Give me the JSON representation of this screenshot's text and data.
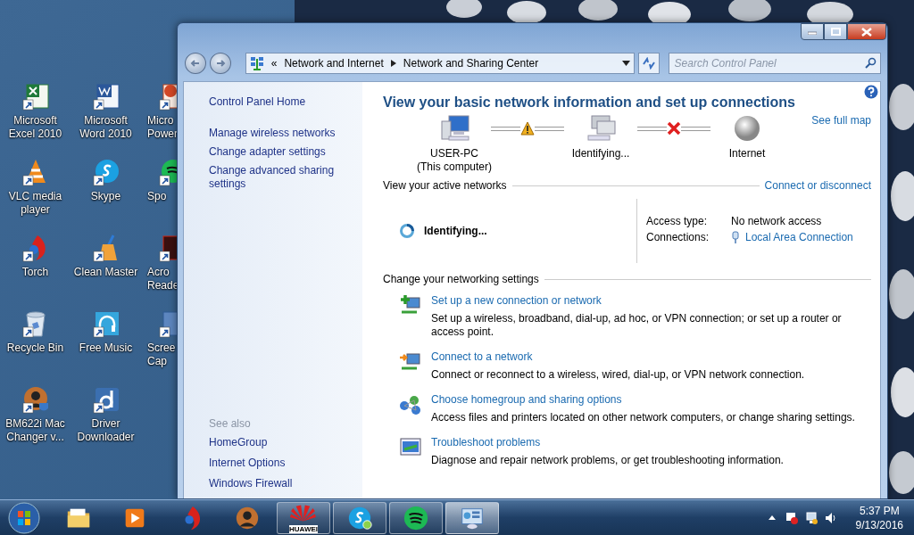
{
  "desktop": {
    "icons": [
      {
        "kind": "spreadsheet",
        "lines": [
          "Microsoft",
          "Excel 2010"
        ]
      },
      {
        "kind": "document",
        "lines": [
          "Microsoft",
          "Word 2010"
        ]
      },
      {
        "kind": "slides",
        "lines": [
          "Micro",
          "Power"
        ]
      },
      {
        "kind": "cone",
        "lines": [
          "VLC media",
          "player"
        ]
      },
      {
        "kind": "chat",
        "lines": [
          "Skype"
        ]
      },
      {
        "kind": "music",
        "lines": [
          "Spo"
        ]
      },
      {
        "kind": "flame",
        "lines": [
          "Torch"
        ]
      },
      {
        "kind": "broom",
        "lines": [
          "Clean Master"
        ]
      },
      {
        "kind": "reader",
        "lines": [
          "Acro",
          "Reade"
        ]
      },
      {
        "kind": "bin",
        "lines": [
          "Recycle Bin"
        ]
      },
      {
        "kind": "headphones",
        "lines": [
          "Free Music"
        ]
      },
      {
        "kind": "capture",
        "lines": [
          "Scree",
          "Cap"
        ]
      },
      {
        "kind": "avatar",
        "lines": [
          "BM622i Mac",
          "Changer v..."
        ]
      },
      {
        "kind": "download",
        "lines": [
          "Driver",
          "Downloader"
        ]
      }
    ]
  },
  "window": {
    "address": {
      "overflow": "«",
      "crumbs": [
        "Network and Internet",
        "Network and Sharing Center"
      ]
    },
    "search": {
      "placeholder": "Search Control Panel"
    },
    "sidebar": {
      "home": "Control Panel Home",
      "tasks": [
        "Manage wireless networks",
        "Change adapter settings",
        "Change advanced sharing settings"
      ],
      "see_also_heading": "See also",
      "see_also": [
        "HomeGroup",
        "Internet Options",
        "Windows Firewall"
      ]
    },
    "title": "View your basic network information and set up connections",
    "map": {
      "see_full_map": "See full map",
      "nodes": [
        {
          "kind": "computer",
          "lines": [
            "USER-PC",
            "(This computer)"
          ]
        },
        {
          "kind": "network",
          "lines": [
            "Identifying..."
          ]
        },
        {
          "kind": "globe",
          "lines": [
            "Internet"
          ]
        }
      ],
      "links": [
        {
          "kind": "warning"
        },
        {
          "kind": "broken"
        }
      ]
    },
    "active_networks": {
      "heading": "View your active networks",
      "action": "Connect or disconnect",
      "network_name": "Identifying...",
      "access_type_label": "Access type:",
      "access_type": "No network access",
      "connections_label": "Connections:",
      "connection": "Local Area Connection"
    },
    "settings": {
      "heading": "Change your networking settings",
      "items": [
        {
          "kind": "new",
          "link": "Set up a new connection or network",
          "description": "Set up a wireless, broadband, dial-up, ad hoc, or VPN connection; or set up a router or access point."
        },
        {
          "kind": "connect",
          "link": "Connect to a network",
          "description": "Connect or reconnect to a wireless, wired, dial-up, or VPN network connection."
        },
        {
          "kind": "homegroup",
          "link": "Choose homegroup and sharing options",
          "description": "Access files and printers located on other network computers, or change sharing settings."
        },
        {
          "kind": "troubleshoot",
          "link": "Troubleshoot problems",
          "description": "Diagnose and repair network problems, or get troubleshooting information."
        }
      ]
    }
  },
  "taskbar": {
    "items": [
      {
        "kind": "folder",
        "open": false,
        "selected": false
      },
      {
        "kind": "player",
        "open": false,
        "selected": false
      },
      {
        "kind": "flame",
        "open": false,
        "selected": false
      },
      {
        "kind": "avatar",
        "open": false,
        "selected": false
      },
      {
        "kind": "huawei",
        "label": "HUAWEI",
        "open": true,
        "selected": false
      },
      {
        "kind": "chat",
        "open": true,
        "selected": false
      },
      {
        "kind": "music",
        "open": true,
        "selected": false
      },
      {
        "kind": "panel",
        "open": true,
        "selected": true
      }
    ],
    "time": "5:37 PM",
    "date": "9/13/2016"
  }
}
